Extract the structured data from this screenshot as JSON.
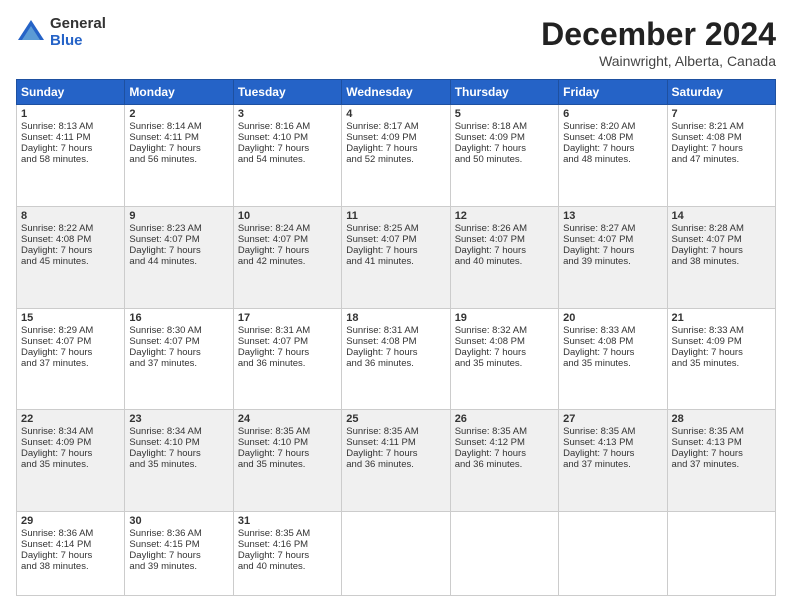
{
  "header": {
    "logo_general": "General",
    "logo_blue": "Blue",
    "month_title": "December 2024",
    "location": "Wainwright, Alberta, Canada"
  },
  "days_of_week": [
    "Sunday",
    "Monday",
    "Tuesday",
    "Wednesday",
    "Thursday",
    "Friday",
    "Saturday"
  ],
  "weeks": [
    [
      {
        "day": "1",
        "sunrise": "Sunrise: 8:13 AM",
        "sunset": "Sunset: 4:11 PM",
        "daylight": "Daylight: 7 hours and 58 minutes."
      },
      {
        "day": "2",
        "sunrise": "Sunrise: 8:14 AM",
        "sunset": "Sunset: 4:11 PM",
        "daylight": "Daylight: 7 hours and 56 minutes."
      },
      {
        "day": "3",
        "sunrise": "Sunrise: 8:16 AM",
        "sunset": "Sunset: 4:10 PM",
        "daylight": "Daylight: 7 hours and 54 minutes."
      },
      {
        "day": "4",
        "sunrise": "Sunrise: 8:17 AM",
        "sunset": "Sunset: 4:09 PM",
        "daylight": "Daylight: 7 hours and 52 minutes."
      },
      {
        "day": "5",
        "sunrise": "Sunrise: 8:18 AM",
        "sunset": "Sunset: 4:09 PM",
        "daylight": "Daylight: 7 hours and 50 minutes."
      },
      {
        "day": "6",
        "sunrise": "Sunrise: 8:20 AM",
        "sunset": "Sunset: 4:08 PM",
        "daylight": "Daylight: 7 hours and 48 minutes."
      },
      {
        "day": "7",
        "sunrise": "Sunrise: 8:21 AM",
        "sunset": "Sunset: 4:08 PM",
        "daylight": "Daylight: 7 hours and 47 minutes."
      }
    ],
    [
      {
        "day": "8",
        "sunrise": "Sunrise: 8:22 AM",
        "sunset": "Sunset: 4:08 PM",
        "daylight": "Daylight: 7 hours and 45 minutes."
      },
      {
        "day": "9",
        "sunrise": "Sunrise: 8:23 AM",
        "sunset": "Sunset: 4:07 PM",
        "daylight": "Daylight: 7 hours and 44 minutes."
      },
      {
        "day": "10",
        "sunrise": "Sunrise: 8:24 AM",
        "sunset": "Sunset: 4:07 PM",
        "daylight": "Daylight: 7 hours and 42 minutes."
      },
      {
        "day": "11",
        "sunrise": "Sunrise: 8:25 AM",
        "sunset": "Sunset: 4:07 PM",
        "daylight": "Daylight: 7 hours and 41 minutes."
      },
      {
        "day": "12",
        "sunrise": "Sunrise: 8:26 AM",
        "sunset": "Sunset: 4:07 PM",
        "daylight": "Daylight: 7 hours and 40 minutes."
      },
      {
        "day": "13",
        "sunrise": "Sunrise: 8:27 AM",
        "sunset": "Sunset: 4:07 PM",
        "daylight": "Daylight: 7 hours and 39 minutes."
      },
      {
        "day": "14",
        "sunrise": "Sunrise: 8:28 AM",
        "sunset": "Sunset: 4:07 PM",
        "daylight": "Daylight: 7 hours and 38 minutes."
      }
    ],
    [
      {
        "day": "15",
        "sunrise": "Sunrise: 8:29 AM",
        "sunset": "Sunset: 4:07 PM",
        "daylight": "Daylight: 7 hours and 37 minutes."
      },
      {
        "day": "16",
        "sunrise": "Sunrise: 8:30 AM",
        "sunset": "Sunset: 4:07 PM",
        "daylight": "Daylight: 7 hours and 37 minutes."
      },
      {
        "day": "17",
        "sunrise": "Sunrise: 8:31 AM",
        "sunset": "Sunset: 4:07 PM",
        "daylight": "Daylight: 7 hours and 36 minutes."
      },
      {
        "day": "18",
        "sunrise": "Sunrise: 8:31 AM",
        "sunset": "Sunset: 4:08 PM",
        "daylight": "Daylight: 7 hours and 36 minutes."
      },
      {
        "day": "19",
        "sunrise": "Sunrise: 8:32 AM",
        "sunset": "Sunset: 4:08 PM",
        "daylight": "Daylight: 7 hours and 35 minutes."
      },
      {
        "day": "20",
        "sunrise": "Sunrise: 8:33 AM",
        "sunset": "Sunset: 4:08 PM",
        "daylight": "Daylight: 7 hours and 35 minutes."
      },
      {
        "day": "21",
        "sunrise": "Sunrise: 8:33 AM",
        "sunset": "Sunset: 4:09 PM",
        "daylight": "Daylight: 7 hours and 35 minutes."
      }
    ],
    [
      {
        "day": "22",
        "sunrise": "Sunrise: 8:34 AM",
        "sunset": "Sunset: 4:09 PM",
        "daylight": "Daylight: 7 hours and 35 minutes."
      },
      {
        "day": "23",
        "sunrise": "Sunrise: 8:34 AM",
        "sunset": "Sunset: 4:10 PM",
        "daylight": "Daylight: 7 hours and 35 minutes."
      },
      {
        "day": "24",
        "sunrise": "Sunrise: 8:35 AM",
        "sunset": "Sunset: 4:10 PM",
        "daylight": "Daylight: 7 hours and 35 minutes."
      },
      {
        "day": "25",
        "sunrise": "Sunrise: 8:35 AM",
        "sunset": "Sunset: 4:11 PM",
        "daylight": "Daylight: 7 hours and 36 minutes."
      },
      {
        "day": "26",
        "sunrise": "Sunrise: 8:35 AM",
        "sunset": "Sunset: 4:12 PM",
        "daylight": "Daylight: 7 hours and 36 minutes."
      },
      {
        "day": "27",
        "sunrise": "Sunrise: 8:35 AM",
        "sunset": "Sunset: 4:13 PM",
        "daylight": "Daylight: 7 hours and 37 minutes."
      },
      {
        "day": "28",
        "sunrise": "Sunrise: 8:35 AM",
        "sunset": "Sunset: 4:13 PM",
        "daylight": "Daylight: 7 hours and 37 minutes."
      }
    ],
    [
      {
        "day": "29",
        "sunrise": "Sunrise: 8:36 AM",
        "sunset": "Sunset: 4:14 PM",
        "daylight": "Daylight: 7 hours and 38 minutes."
      },
      {
        "day": "30",
        "sunrise": "Sunrise: 8:36 AM",
        "sunset": "Sunset: 4:15 PM",
        "daylight": "Daylight: 7 hours and 39 minutes."
      },
      {
        "day": "31",
        "sunrise": "Sunrise: 8:35 AM",
        "sunset": "Sunset: 4:16 PM",
        "daylight": "Daylight: 7 hours and 40 minutes."
      },
      null,
      null,
      null,
      null
    ]
  ]
}
